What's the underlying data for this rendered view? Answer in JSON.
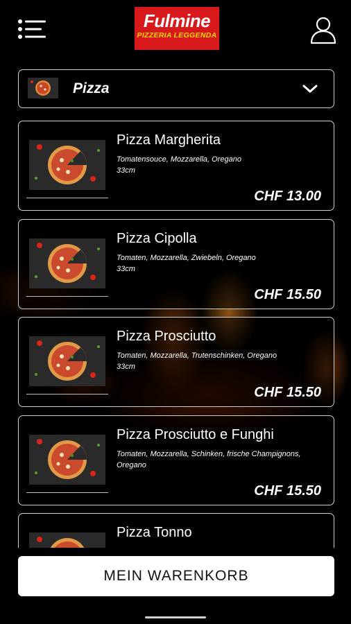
{
  "header": {
    "logo_name": "Fulmine",
    "logo_tagline": "PIZZERIA LEGGENDA",
    "menu_icon": "hamburger-menu-icon",
    "user_icon": "user-profile-icon"
  },
  "category": {
    "label": "Pizza",
    "icon": "chevron-down-icon"
  },
  "products": [
    {
      "title": "Pizza Margherita",
      "desc": "Tomatensouce, Mozzarella, Oregano",
      "size": "33cm",
      "price": "CHF 13.00"
    },
    {
      "title": "Pizza Cipolla",
      "desc": "Tomaten, Mozzarella, Zwiebeln, Oregano",
      "size": "33cm",
      "price": "CHF 15.50"
    },
    {
      "title": "Pizza Prosciutto",
      "desc": "Tomaten, Mozzarella, Trutenschinken, Oregano",
      "size": "33cm",
      "price": "CHF 15.50"
    },
    {
      "title": "Pizza Prosciutto e Funghi",
      "desc": "Tomaten, Mozzarella, Schinken, frische Champignons, Oregano",
      "size": "",
      "price": "CHF 15.50"
    },
    {
      "title": "Pizza Tonno",
      "desc": "",
      "size": "",
      "price": ""
    }
  ],
  "cart": {
    "label": "MEIN WARENKORB"
  },
  "colors": {
    "logo_bg": "#d7191c",
    "logo_tagline": "#ffd800",
    "border": "#cfcfcf"
  }
}
